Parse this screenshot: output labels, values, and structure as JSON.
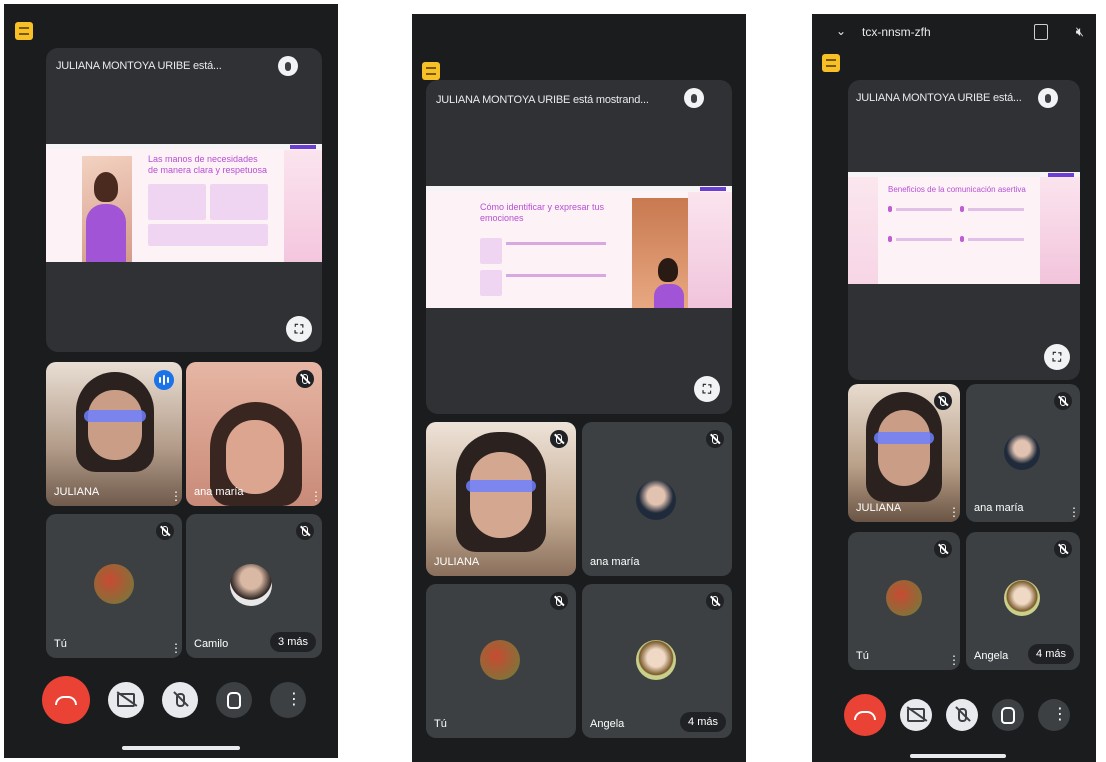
{
  "presenting_title_short": "JULIANA MONTOYA URIBE está...",
  "presenting_title_long": "JULIANA MONTOYA URIBE está mostrand...",
  "meeting_code": "tcx-nnsm-zfh",
  "participants": {
    "juliana": "JULIANA",
    "ana": "ana maría",
    "you": "Tú",
    "camilo": "Camilo",
    "angela": "Angela"
  },
  "more_three": "3 más",
  "more_four": "4 más",
  "slides": {
    "s1_title": "Las manos de necesidades de manera clara y respetuosa",
    "s2_title": "Cómo identificar y expresar tus emociones",
    "s3_title": "Beneficios de la comunicación asertiva"
  },
  "colors": {
    "end_call": "#ea4335",
    "speaking": "#1a73e8",
    "tile": "#3c4043",
    "background": "#1b1c1e"
  },
  "icons": [
    "sheet-icon",
    "mic-icon",
    "fullscreen-icon",
    "mic-off-icon",
    "speaking-icon",
    "end-call-icon",
    "camera-off-icon",
    "hand-icon",
    "more-vert-icon",
    "chevron-down-icon",
    "rotate-icon",
    "volume-off-icon"
  ]
}
